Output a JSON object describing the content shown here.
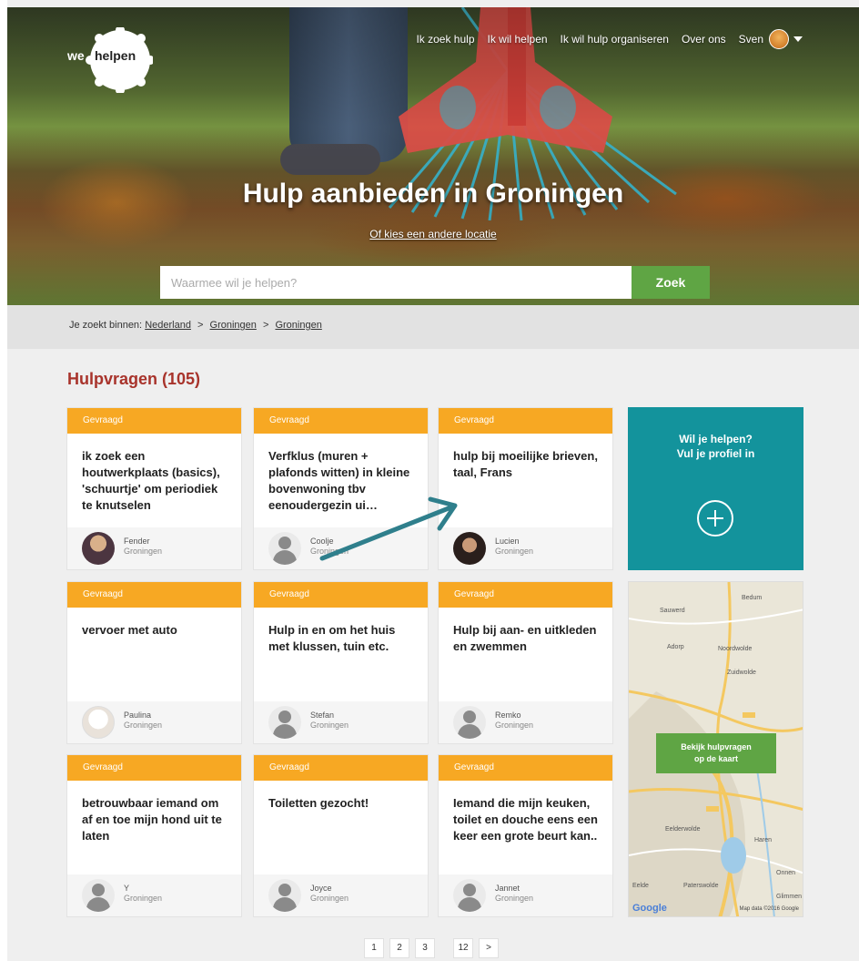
{
  "logo": {
    "we": "we",
    "helpen": "helpen"
  },
  "nav": {
    "items": [
      "Ik zoek hulp",
      "Ik wil helpen",
      "Ik wil hulp organiseren",
      "Over ons"
    ],
    "user": "Sven"
  },
  "hero": {
    "title": "Hulp aanbieden in Groningen",
    "sub_link": "Of kies een andere locatie",
    "search_placeholder": "Waarmee wil je helpen?",
    "search_button": "Zoek"
  },
  "breadcrumb": {
    "prefix": "Je zoekt binnen:",
    "items": [
      "Nederland",
      "Groningen",
      "Groningen"
    ],
    "separator": ">"
  },
  "section": {
    "title": "Hulpvragen (105)"
  },
  "cards": [
    {
      "status": "Gevraagd",
      "title": "ik zoek een houtwerkplaats (basics), 'schuurtje' om periodiek te knutselen",
      "user": "Fender",
      "city": "Groningen"
    },
    {
      "status": "Gevraagd",
      "title": "Verfklus (muren + plafonds witten) in kleine bovenwoning tbv eenoudergezin ui…",
      "user": "Coolje",
      "city": "Groningen"
    },
    {
      "status": "Gevraagd",
      "title": "hulp bij moeilijke brieven, taal, Frans",
      "user": "Lucien",
      "city": "Groningen"
    },
    {
      "status": "Gevraagd",
      "title": "vervoer met auto",
      "user": "Paulina",
      "city": "Groningen"
    },
    {
      "status": "Gevraagd",
      "title": "Hulp in en om het huis met klussen, tuin etc.",
      "user": "Stefan",
      "city": "Groningen"
    },
    {
      "status": "Gevraagd",
      "title": "Hulp bij aan- en uitkleden en zwemmen",
      "user": "Remko",
      "city": "Groningen"
    },
    {
      "status": "Gevraagd",
      "title": "betrouwbaar iemand om af en toe mijn hond uit te laten",
      "user": "Y",
      "city": "Groningen"
    },
    {
      "status": "Gevraagd",
      "title": "Toiletten gezocht!",
      "user": "Joyce",
      "city": "Groningen"
    },
    {
      "status": "Gevraagd",
      "title": "Iemand die mijn keuken, toilet en douche eens een keer een grote beurt kan..",
      "user": "Jannet",
      "city": "Groningen"
    }
  ],
  "cta": {
    "line1": "Wil je helpen?",
    "line2": "Vul je profiel in"
  },
  "map": {
    "button_line1": "Bekijk hulpvragen",
    "button_line2": "op de kaart",
    "labels": [
      "Sauwerd",
      "Bedum",
      "Adorp",
      "Noordwolde",
      "Zuidwolde",
      "Eelderwolde",
      "Haren",
      "Paterswolde",
      "Onnen",
      "Glimmen",
      "Eelde"
    ],
    "google": "Google",
    "attribution": "Map data ©2016 Google"
  },
  "pager": [
    "1",
    "2",
    "3",
    "12",
    ">"
  ],
  "colors": {
    "accent_orange": "#f7a823",
    "teal": "#13939c",
    "green": "#5fa544",
    "title_red": "#a8332b"
  }
}
